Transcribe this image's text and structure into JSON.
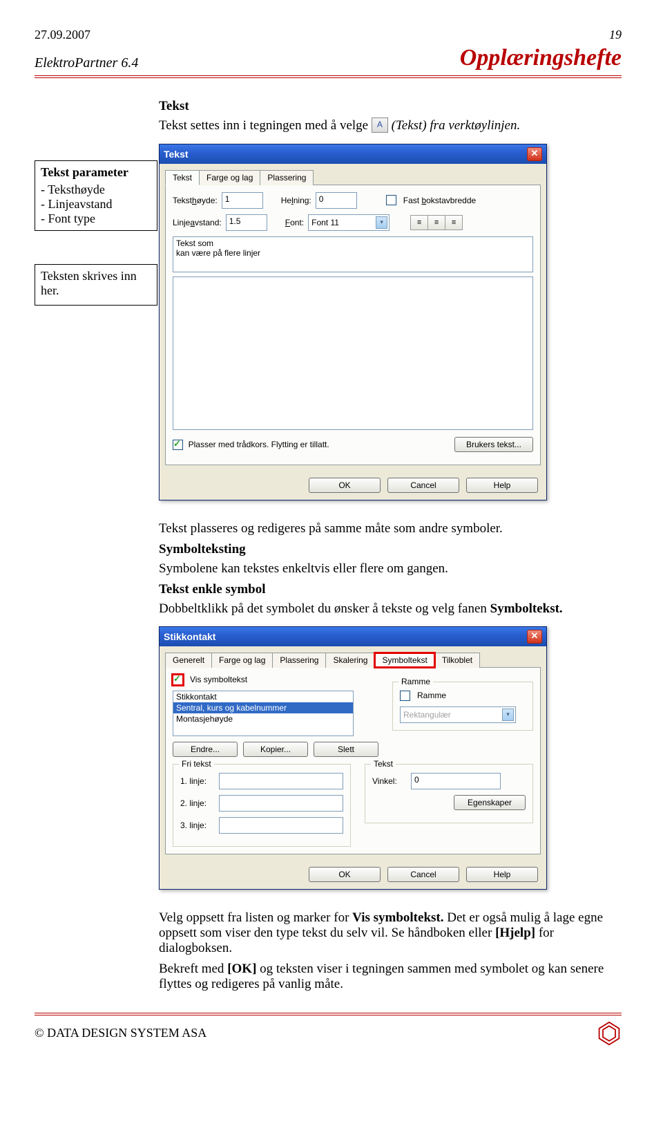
{
  "header": {
    "date": "27.09.2007",
    "page_number": "19",
    "product": "ElektroPartner 6.4",
    "title": "Opplæringshefte"
  },
  "intro": {
    "heading": "Tekst",
    "line_a": "Tekst settes inn i tegningen med å velge",
    "line_b": "(Tekst) fra verktøylinjen."
  },
  "sidebox1": {
    "title": "Tekst parameter",
    "items": [
      "Teksthøyde",
      "Linjeavstand",
      "Font type"
    ]
  },
  "sidebox2": {
    "text": "Teksten skrives inn her."
  },
  "dialog1": {
    "title": "Tekst",
    "tabs": [
      "Tekst",
      "Farge og lag",
      "Plassering"
    ],
    "fields": {
      "height_label": "Teksthøyde:",
      "height_value": "1",
      "lean_label": "Helning:",
      "lean_value": "0",
      "fixed_label": "Fast bokstavbredde",
      "linespace_label": "Linjeavstand:",
      "linespace_value": "1.5",
      "font_label": "Font:",
      "font_value": "Font 11"
    },
    "textarea_lines": "Tekst som\nkan være på flere linjer",
    "bottom_check": "Plasser med trådkors. Flytting er tillatt.",
    "user_text_btn": "Brukers tekst...",
    "buttons": [
      "OK",
      "Cancel",
      "Help"
    ]
  },
  "mid": {
    "p1": "Tekst plasseres og redigeres på samme måte som andre symboler.",
    "h2": "Symbolteksting",
    "p2": "Symbolene kan tekstes enkeltvis eller flere om gangen.",
    "h3": "Tekst enkle symbol",
    "p3a": "Dobbeltklikk på det symbolet du ønsker å tekste og velg fanen",
    "p3b": "Symboltekst."
  },
  "dialog2": {
    "title": "Stikkontakt",
    "tabs": [
      "Generelt",
      "Farge og lag",
      "Plassering",
      "Skalering",
      "Symboltekst",
      "Tilkoblet"
    ],
    "show_label": "Vis symboltekst",
    "list_options": [
      "Stikkontakt",
      "Sentral, kurs og kabelnummer",
      "Montasjehøyde"
    ],
    "small_buttons": [
      "Endre...",
      "Kopier...",
      "Slett"
    ],
    "frame_group": "Ramme",
    "frame_check": "Ramme",
    "frame_shape": "Rektangulær",
    "free_group": "Fri tekst",
    "free_labels": [
      "1. linje:",
      "2. linje:",
      "3. linje:"
    ],
    "text_group": "Tekst",
    "angle_label": "Vinkel:",
    "angle_value": "0",
    "props_btn": "Egenskaper",
    "buttons": [
      "OK",
      "Cancel",
      "Help"
    ]
  },
  "end": {
    "p1a": "Velg oppsett fra listen og marker for",
    "p1b": "Vis symboltekst.",
    "p1c": "Det er også mulig å lage egne oppsett som viser den type tekst du selv vil. Se håndboken eller",
    "p1d": "[Hjelp]",
    "p1e": "for dialogboksen.",
    "p2a": "Bekreft med",
    "p2b": "[OK]",
    "p2c": "og teksten viser i tegningen sammen med symbolet og kan senere flyttes og redigeres på vanlig måte."
  },
  "footer": {
    "copyright": "© DATA DESIGN SYSTEM ASA"
  }
}
